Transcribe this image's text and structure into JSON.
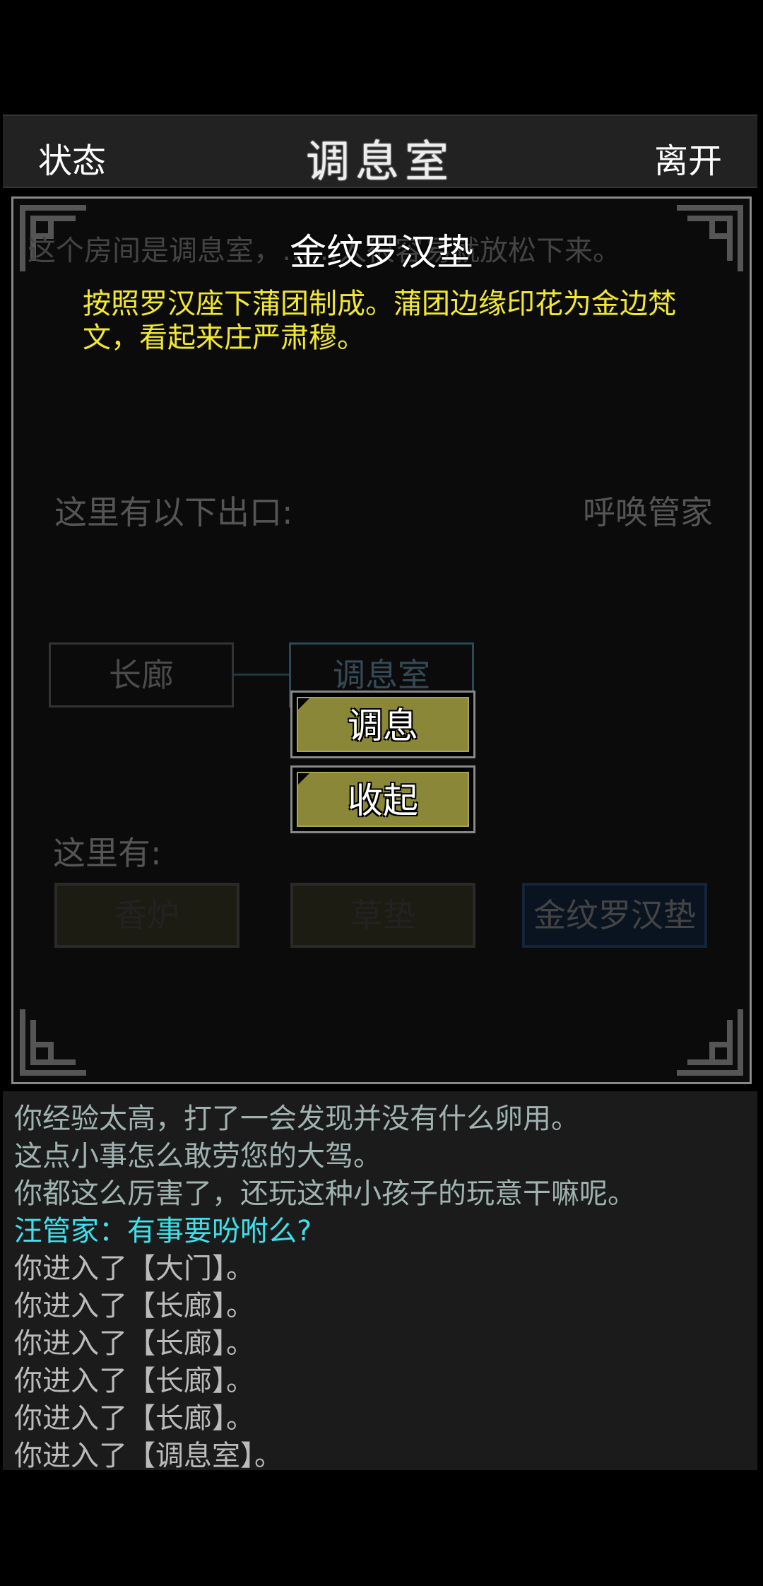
{
  "header": {
    "left_button": "状态",
    "title": "调息室",
    "right_button": "离开"
  },
  "room": {
    "description": "这个房间是调息室，……人很容易就放松下来。",
    "exits_label": "这里有以下出口:",
    "summon_button": "呼唤管家",
    "map": {
      "corridor": "长廊",
      "current": "调息室"
    },
    "here_label": "这里有:",
    "items": [
      "香炉",
      "草垫",
      "金纹罗汉垫"
    ]
  },
  "popup": {
    "title": "金纹罗汉垫",
    "description": "按照罗汉座下蒲团制成。蒲团边缘印花为金边梵文，看起来庄严肃穆。",
    "actions": {
      "rest": "调息",
      "close": "收起"
    }
  },
  "log": {
    "lines": [
      {
        "text": "你经验太高，打了一会发现并没有什么卵用。",
        "color": "#9fb3b0"
      },
      {
        "text": "这点小事怎么敢劳您的大驾。",
        "color": "#9fb3b0"
      },
      {
        "text": "你都这么厉害了，还玩这种小孩子的玩意干嘛呢。",
        "color": "#9fb3b0"
      },
      {
        "text": "汪管家：有事要吩咐么?",
        "color": "#3fe0ea"
      },
      {
        "text": "你进入了【大门】。",
        "color": "#bbbbbb"
      },
      {
        "text": "你进入了【长廊】。",
        "color": "#bbbbbb"
      },
      {
        "text": "你进入了【长廊】。",
        "color": "#bbbbbb"
      },
      {
        "text": "你进入了【长廊】。",
        "color": "#bbbbbb"
      },
      {
        "text": "你进入了【长廊】。",
        "color": "#bbbbbb"
      },
      {
        "text": "你进入了【调息室】。",
        "color": "#bbbbbb"
      }
    ]
  }
}
